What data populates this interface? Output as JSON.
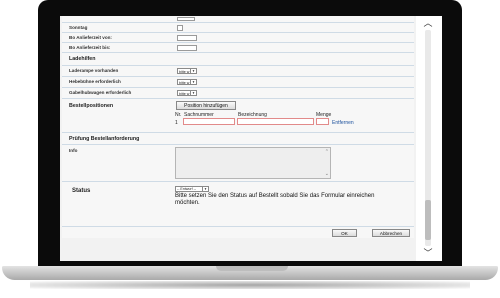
{
  "form": {
    "sonntag_label": "Sonntag",
    "anlieferzeit_von_label": "Bo Anlieferzeit von:",
    "anlieferzeit_bis_label": "Bo Anlieferzeit bis:",
    "ladehilfen_heading": "Ladehilfen",
    "laderampe_label": "Laderampe vorhanden",
    "hebebuehne_label": "Hebebühne erforderlich",
    "gabelhubwagen_label": "Gabelhubwagen erforderlich",
    "bitte_waehlen": "bitte w",
    "bestellpositionen_heading": "Bestellpositionen",
    "position_button": "Position hinzufügen",
    "col_nr": "Nr.",
    "col_sachnummer": "Sachnummer",
    "col_bezeichnung": "Bezeichnung",
    "col_menge": "Menge",
    "row_number": "1",
    "entfernen_link": "Entfernen",
    "pruefung_heading": "Prüfung Bestellanforderung",
    "info_label": "Info",
    "status_label": "Status",
    "status_value": "-- Entwurf --",
    "status_hint": "Bitte setzen Sie den Status auf Bestellt sobald Sie das Formular einreichen möchten.",
    "ok_button": "OK",
    "abbrechen_button": "Abbrechen"
  },
  "scrollbar": {
    "up_icon": "chevron-up",
    "down_icon": "chevron-down"
  }
}
